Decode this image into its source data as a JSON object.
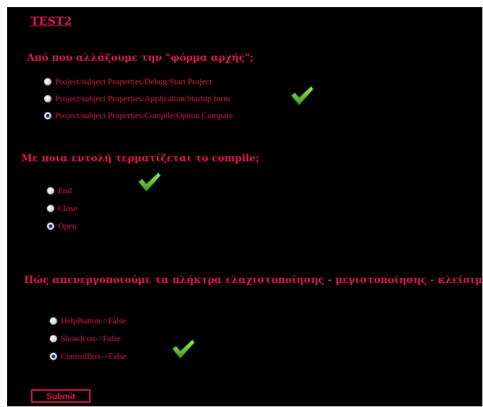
{
  "title": "TEST2",
  "questions": [
    {
      "text": "Από που αλλάζουμε την \"φόρμα αρχής\";",
      "options": [
        {
          "label": "Project/subject Properties/Debug/Start Project",
          "selected": false
        },
        {
          "label": "Project/subject Properties/Application/Startup form",
          "selected": false
        },
        {
          "label": "Project/subject Properties/Compile/Option Compare",
          "selected": true
        }
      ],
      "correct_index": 1
    },
    {
      "text": "Με ποια εντολή τερματίζεται το compile;",
      "options": [
        {
          "label": "End",
          "selected": false
        },
        {
          "label": "Close",
          "selected": false
        },
        {
          "label": "Open",
          "selected": true
        }
      ],
      "correct_index": 0
    },
    {
      "text": "Πώς απενεργοποιούμε τα πλήκτρα ελαχιστοποίησης - μεγιστοποίησης - κλείσιμο;",
      "options": [
        {
          "label": "HelpButton->False",
          "selected": false
        },
        {
          "label": "ShowIcon->False",
          "selected": false
        },
        {
          "label": "ControlBox->False",
          "selected": true
        }
      ],
      "correct_index": 2
    }
  ],
  "submit_label": "Submit",
  "colors": {
    "accent": "#e0164f",
    "background": "#000000",
    "check": "#5bbf2a"
  },
  "icons": {
    "correct": "green-checkmark-icon"
  }
}
